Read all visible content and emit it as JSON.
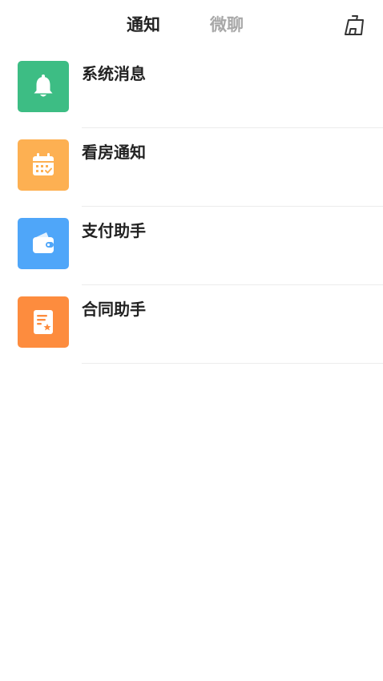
{
  "header": {
    "tabs": [
      {
        "label": "通知",
        "active": true
      },
      {
        "label": "微聊",
        "active": false
      }
    ],
    "clear_icon": "broom-clear-icon"
  },
  "notifications": [
    {
      "title": "系统消息",
      "icon": "bell-icon",
      "color": "#3dbd84"
    },
    {
      "title": "看房通知",
      "icon": "calendar-icon",
      "color": "#fdb052"
    },
    {
      "title": "支付助手",
      "icon": "wallet-icon",
      "color": "#4fa6f9"
    },
    {
      "title": "合同助手",
      "icon": "contract-icon",
      "color": "#fd8c3e"
    }
  ],
  "colors": {
    "active_tab": "#222222",
    "inactive_tab": "#a8a8a8",
    "divider": "#ececec"
  }
}
